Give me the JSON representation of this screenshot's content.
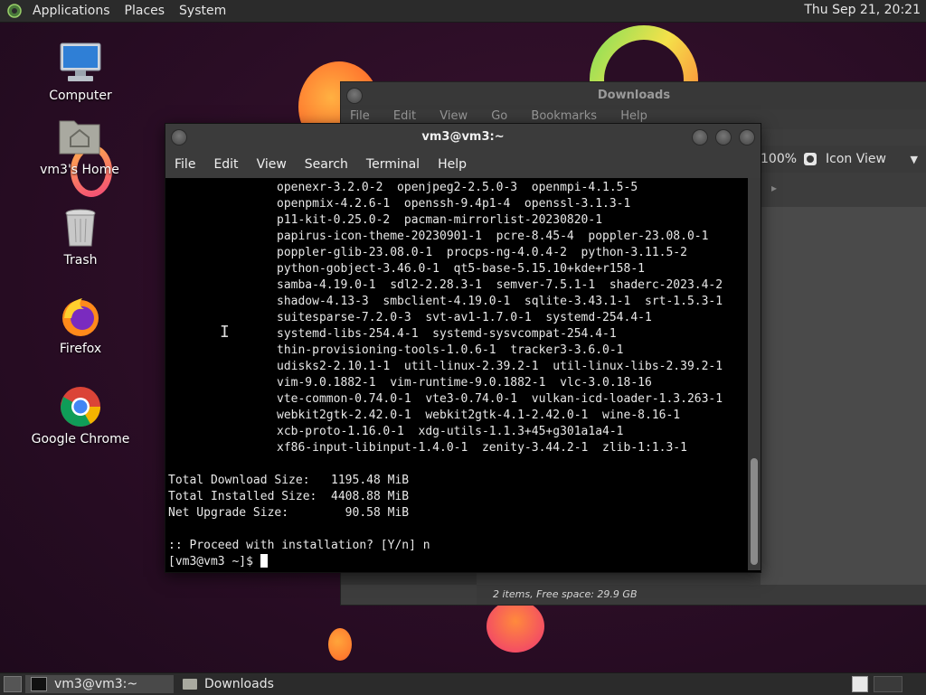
{
  "top_panel": {
    "menus": [
      "Applications",
      "Places",
      "System"
    ],
    "clock": "Thu Sep 21, 20:21"
  },
  "desktop_icons": [
    {
      "label": "Computer",
      "icon": "computer-icon"
    },
    {
      "label": "vm3's Home",
      "icon": "home-folder-icon"
    },
    {
      "label": "Trash",
      "icon": "trash-icon"
    },
    {
      "label": "Firefox",
      "icon": "firefox-icon"
    },
    {
      "label": "Google Chrome",
      "icon": "chrome-icon"
    }
  ],
  "file_manager": {
    "title": "Downloads",
    "menu": [
      "File",
      "Edit",
      "View",
      "Go",
      "Bookmarks",
      "Help"
    ],
    "zoom": "100%",
    "view_mode": "Icon View",
    "status": "2 items, Free space: 29.9 GB"
  },
  "terminal": {
    "title": "vm3@vm3:~",
    "menu": [
      "File",
      "Edit",
      "View",
      "Search",
      "Terminal",
      "Help"
    ],
    "package_lines": [
      "openexr-3.2.0-2  openjpeg2-2.5.0-3  openmpi-4.1.5-5",
      "openpmix-4.2.6-1  openssh-9.4p1-4  openssl-3.1.3-1",
      "p11-kit-0.25.0-2  pacman-mirrorlist-20230820-1",
      "papirus-icon-theme-20230901-1  pcre-8.45-4  poppler-23.08.0-1",
      "poppler-glib-23.08.0-1  procps-ng-4.0.4-2  python-3.11.5-2",
      "python-gobject-3.46.0-1  qt5-base-5.15.10+kde+r158-1",
      "samba-4.19.0-1  sdl2-2.28.3-1  semver-7.5.1-1  shaderc-2023.4-2",
      "shadow-4.13-3  smbclient-4.19.0-1  sqlite-3.43.1-1  srt-1.5.3-1",
      "suitesparse-7.2.0-3  svt-av1-1.7.0-1  systemd-254.4-1",
      "systemd-libs-254.4-1  systemd-sysvcompat-254.4-1",
      "thin-provisioning-tools-1.0.6-1  tracker3-3.6.0-1",
      "udisks2-2.10.1-1  util-linux-2.39.2-1  util-linux-libs-2.39.2-1",
      "vim-9.0.1882-1  vim-runtime-9.0.1882-1  vlc-3.0.18-16",
      "vte-common-0.74.0-1  vte3-0.74.0-1  vulkan-icd-loader-1.3.263-1",
      "webkit2gtk-2.42.0-1  webkit2gtk-4.1-2.42.0-1  wine-8.16-1",
      "xcb-proto-1.16.0-1  xdg-utils-1.1.3+45+g301a1a4-1",
      "xf86-input-libinput-1.4.0-1  zenity-3.44.2-1  zlib-1:1.3-1"
    ],
    "summary": {
      "download": "Total Download Size:   1195.48 MiB",
      "installed": "Total Installed Size:  4408.88 MiB",
      "upgrade": "Net Upgrade Size:        90.58 MiB"
    },
    "prompt_question": ":: Proceed with installation? [Y/n] n",
    "prompt": "[vm3@vm3 ~]$ "
  },
  "taskbar": {
    "tasks": [
      {
        "label": "vm3@vm3:~",
        "active": true
      },
      {
        "label": "Downloads",
        "active": false
      }
    ]
  }
}
